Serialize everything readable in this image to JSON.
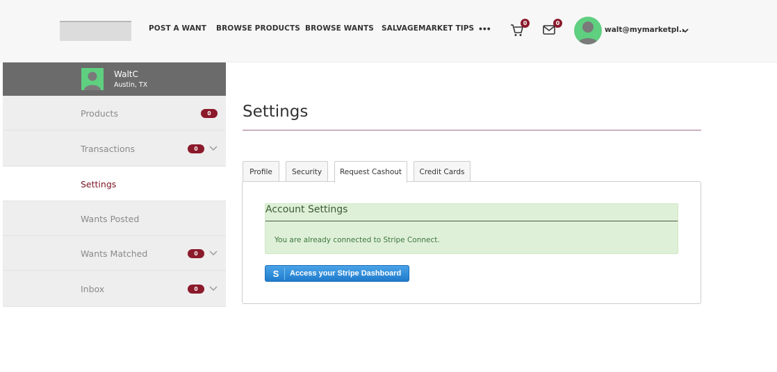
{
  "header": {
    "nav": [
      {
        "label": "POST A WANT"
      },
      {
        "label": "BROWSE PRODUCTS"
      },
      {
        "label": "BROWSE WANTS"
      },
      {
        "label": "SALVAGEMARKET TIPS"
      }
    ],
    "more_label": "•••",
    "cart_count": "0",
    "messages_count": "0",
    "user_email": "walt@mymarketpl..",
    "icons": {
      "cart": "cart-icon",
      "mail": "mail-icon",
      "more": "more-icon",
      "chevron": "chevron-down-icon"
    }
  },
  "sidebar": {
    "profile": {
      "name": "WaltC",
      "location": "Austin, TX"
    },
    "items": [
      {
        "label": "Products",
        "badge": "0",
        "chevron": false,
        "active": false
      },
      {
        "label": "Transactions",
        "badge": "0",
        "chevron": true,
        "active": false
      },
      {
        "label": "Settings",
        "badge": null,
        "chevron": false,
        "active": true
      },
      {
        "label": "Wants Posted",
        "badge": null,
        "chevron": false,
        "active": false
      },
      {
        "label": "Wants Matched",
        "badge": "0",
        "chevron": true,
        "active": false
      },
      {
        "label": "Inbox",
        "badge": "0",
        "chevron": true,
        "active": false
      }
    ]
  },
  "main": {
    "title": "Settings",
    "tabs": [
      {
        "label": "Profile"
      },
      {
        "label": "Security"
      },
      {
        "label": "Request Cashout"
      },
      {
        "label": "Credit Cards"
      }
    ],
    "active_tab": "Request Cashout",
    "alert": {
      "title": "Account Settings",
      "message": "You are already connected to Stripe Connect."
    },
    "stripe_button": {
      "icon_letter": "S",
      "label": "Access your Stripe Dashboard"
    }
  },
  "colors": {
    "accent": "#8b1a2b",
    "avatar": "#5fcf80",
    "alert_bg": "#dff0d8",
    "stripe_blue": "#1f7ccc"
  }
}
